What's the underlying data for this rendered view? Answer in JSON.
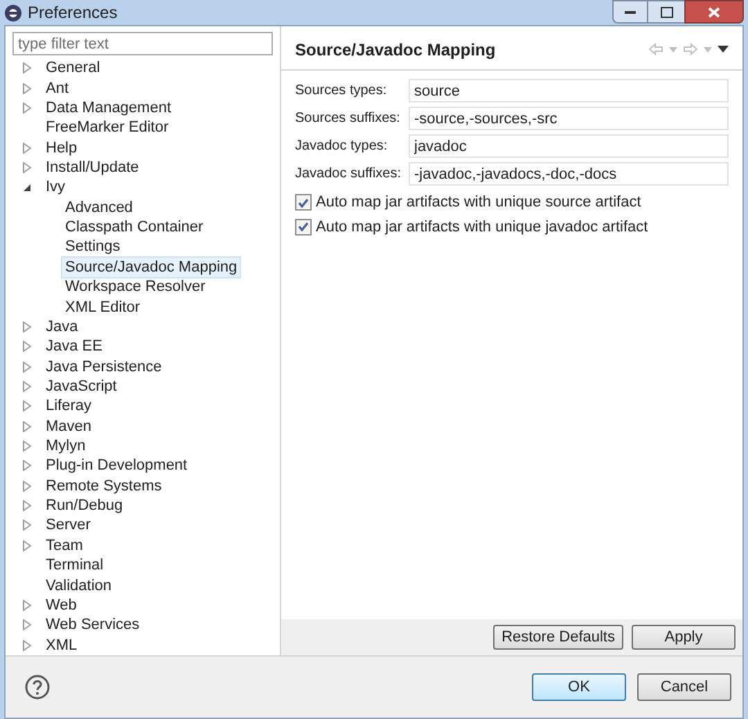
{
  "window": {
    "title": "Preferences"
  },
  "filter": {
    "placeholder": "type filter text"
  },
  "tree": [
    {
      "label": "General",
      "kind": "folder",
      "expanded": false,
      "selected": false
    },
    {
      "label": "Ant",
      "kind": "folder",
      "expanded": false,
      "selected": false
    },
    {
      "label": "Data Management",
      "kind": "folder",
      "expanded": false,
      "selected": false
    },
    {
      "label": "FreeMarker Editor",
      "kind": "leaf",
      "selected": false
    },
    {
      "label": "Help",
      "kind": "folder",
      "expanded": false,
      "selected": false
    },
    {
      "label": "Install/Update",
      "kind": "folder",
      "expanded": false,
      "selected": false
    },
    {
      "label": "Ivy",
      "kind": "folder",
      "expanded": true,
      "selected": false,
      "children": [
        {
          "label": "Advanced",
          "selected": false
        },
        {
          "label": "Classpath Container",
          "selected": false
        },
        {
          "label": "Settings",
          "selected": false
        },
        {
          "label": "Source/Javadoc Mapping",
          "selected": true
        },
        {
          "label": "Workspace Resolver",
          "selected": false
        },
        {
          "label": "XML Editor",
          "selected": false
        }
      ]
    },
    {
      "label": "Java",
      "kind": "folder",
      "expanded": false,
      "selected": false
    },
    {
      "label": "Java EE",
      "kind": "folder",
      "expanded": false,
      "selected": false
    },
    {
      "label": "Java Persistence",
      "kind": "folder",
      "expanded": false,
      "selected": false
    },
    {
      "label": "JavaScript",
      "kind": "folder",
      "expanded": false,
      "selected": false
    },
    {
      "label": "Liferay",
      "kind": "folder",
      "expanded": false,
      "selected": false
    },
    {
      "label": "Maven",
      "kind": "folder",
      "expanded": false,
      "selected": false
    },
    {
      "label": "Mylyn",
      "kind": "folder",
      "expanded": false,
      "selected": false
    },
    {
      "label": "Plug-in Development",
      "kind": "folder",
      "expanded": false,
      "selected": false
    },
    {
      "label": "Remote Systems",
      "kind": "folder",
      "expanded": false,
      "selected": false
    },
    {
      "label": "Run/Debug",
      "kind": "folder",
      "expanded": false,
      "selected": false
    },
    {
      "label": "Server",
      "kind": "folder",
      "expanded": false,
      "selected": false
    },
    {
      "label": "Team",
      "kind": "folder",
      "expanded": false,
      "selected": false
    },
    {
      "label": "Terminal",
      "kind": "leaf",
      "selected": false
    },
    {
      "label": "Validation",
      "kind": "leaf",
      "selected": false
    },
    {
      "label": "Web",
      "kind": "folder",
      "expanded": false,
      "selected": false
    },
    {
      "label": "Web Services",
      "kind": "folder",
      "expanded": false,
      "selected": false
    },
    {
      "label": "XML",
      "kind": "folder",
      "expanded": false,
      "selected": false
    }
  ],
  "page": {
    "title": "Source/Javadoc Mapping",
    "fields": [
      {
        "label": "Sources types:",
        "value": "source"
      },
      {
        "label": "Sources suffixes:",
        "value": "-source,-sources,-src"
      },
      {
        "label": "Javadoc types:",
        "value": "javadoc"
      },
      {
        "label": "Javadoc suffixes:",
        "value": "-javadoc,-javadocs,-doc,-docs"
      }
    ],
    "options": [
      {
        "label": "Auto map jar artifacts with unique source artifact",
        "checked": true
      },
      {
        "label": "Auto map jar artifacts with unique javadoc artifact",
        "checked": true
      }
    ],
    "buttons": [
      "Restore Defaults",
      "Apply"
    ]
  },
  "dialog_buttons": [
    {
      "label": "OK",
      "selected": true
    },
    {
      "label": "Cancel",
      "selected": false
    }
  ]
}
